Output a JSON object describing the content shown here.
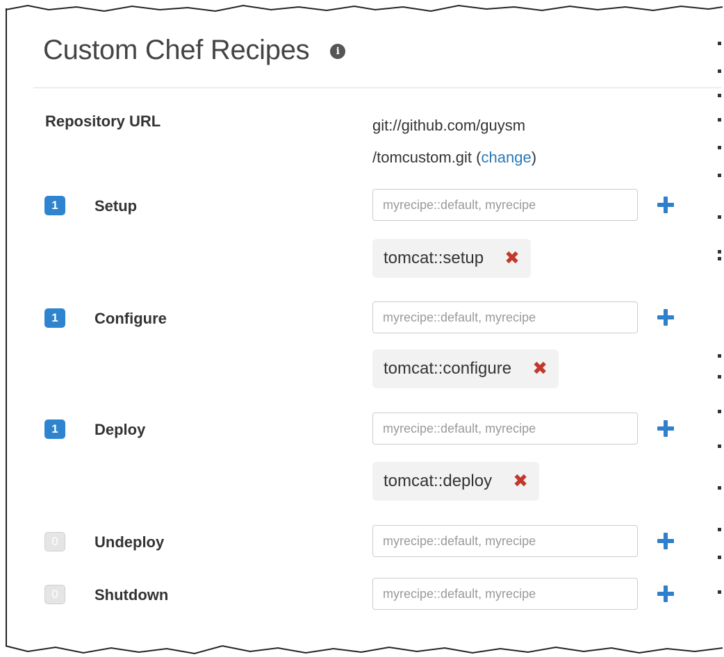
{
  "panel": {
    "title": "Custom Chef Recipes",
    "info_icon": "info-icon",
    "info_glyph": "i"
  },
  "repository": {
    "label": "Repository URL",
    "url_line1": "git://github.com/guysm",
    "url_line2": "/tomcustom.git",
    "open_paren": " (",
    "change_label": "change",
    "close_paren": ")"
  },
  "events": [
    {
      "count": "1",
      "active": true,
      "label": "Setup",
      "placeholder": "myrecipe::default, myrecipe",
      "tags": [
        "tomcat::setup"
      ]
    },
    {
      "count": "1",
      "active": true,
      "label": "Configure",
      "placeholder": "myrecipe::default, myrecipe",
      "tags": [
        "tomcat::configure"
      ]
    },
    {
      "count": "1",
      "active": true,
      "label": "Deploy",
      "placeholder": "myrecipe::default, myrecipe",
      "tags": [
        "tomcat::deploy"
      ]
    },
    {
      "count": "0",
      "active": false,
      "label": "Undeploy",
      "placeholder": "myrecipe::default, myrecipe",
      "tags": []
    },
    {
      "count": "0",
      "active": false,
      "label": "Shutdown",
      "placeholder": "myrecipe::default, myrecipe",
      "tags": []
    }
  ],
  "icons": {
    "add": "plus-icon",
    "remove": "remove-x-icon",
    "remove_glyph": "✖"
  },
  "colors": {
    "badge_active": "#2f84d0",
    "badge_inactive": "#e5e5e5",
    "plus": "#2f7fca",
    "remove": "#c0392b",
    "link": "#2a7ab8"
  }
}
